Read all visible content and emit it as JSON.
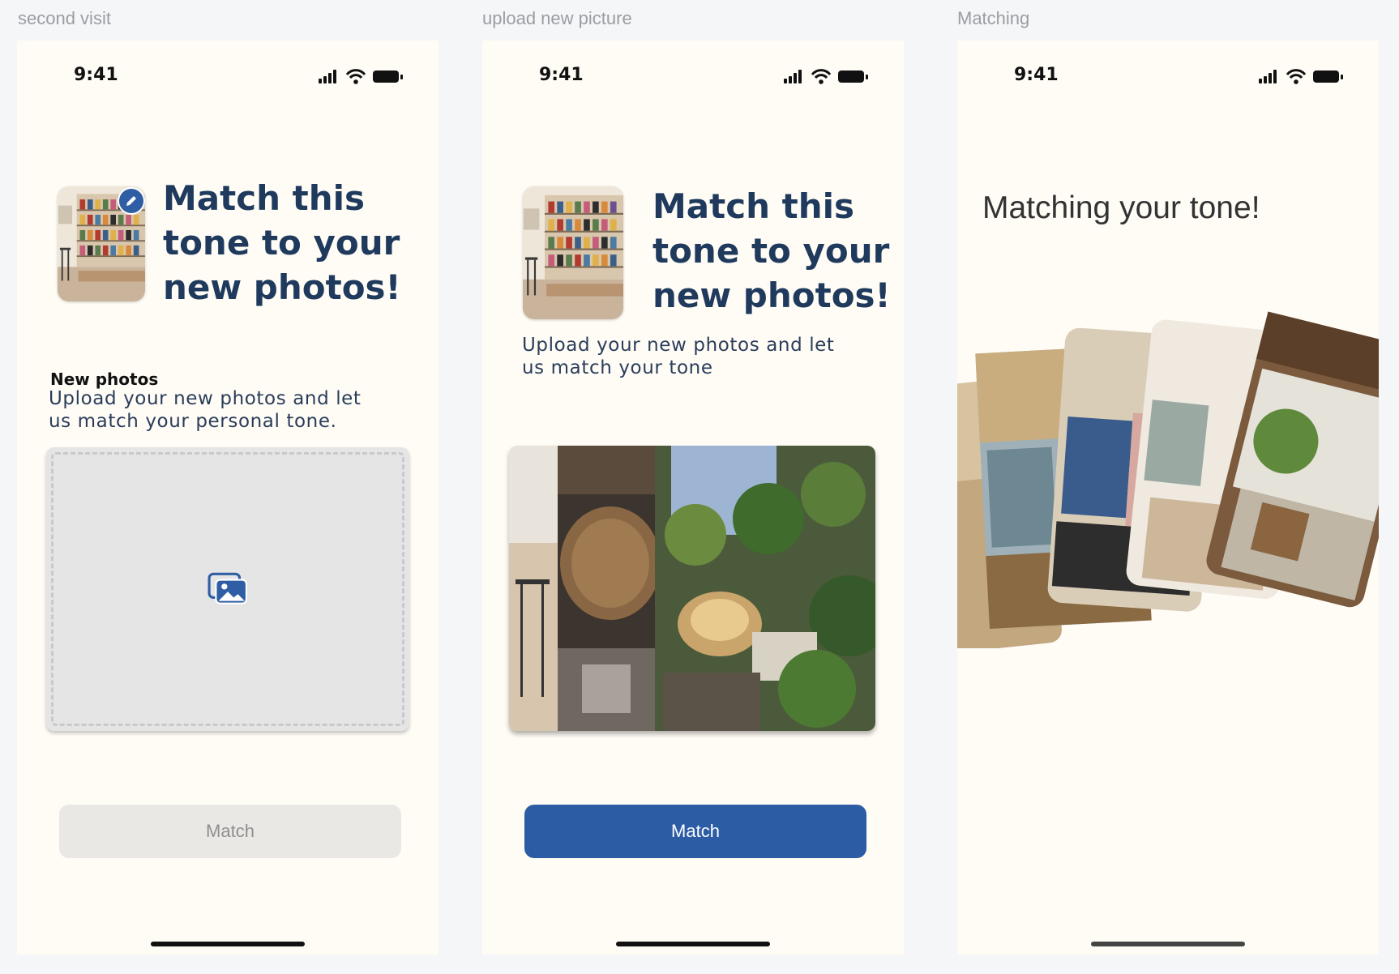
{
  "frames": [
    {
      "label": "second visit",
      "status_time": "9:41",
      "headline": [
        "Match this",
        "tone to your",
        "new photos!"
      ],
      "section_title": "New photos",
      "description": [
        "Upload your new photos and let",
        "us match your personal tone."
      ],
      "button_label": "Match",
      "button_state": "disabled"
    },
    {
      "label": "upload new picture",
      "status_time": "9:41",
      "headline": [
        "Match this",
        "tone to your",
        "new photos!"
      ],
      "description": [
        "Upload your new photos and let",
        "us match your tone"
      ],
      "button_label": "Match",
      "button_state": "enabled"
    },
    {
      "label": "Matching",
      "status_time": "9:41",
      "title": "Matching your tone!"
    }
  ],
  "colors": {
    "primary": "#2c5ca4",
    "headline": "#1f3a5c",
    "background": "#fffcf6",
    "disabled_button": "#e9e8e4"
  },
  "icons": {
    "upload": "photo-gallery-icon",
    "edit": "pencil-icon"
  }
}
